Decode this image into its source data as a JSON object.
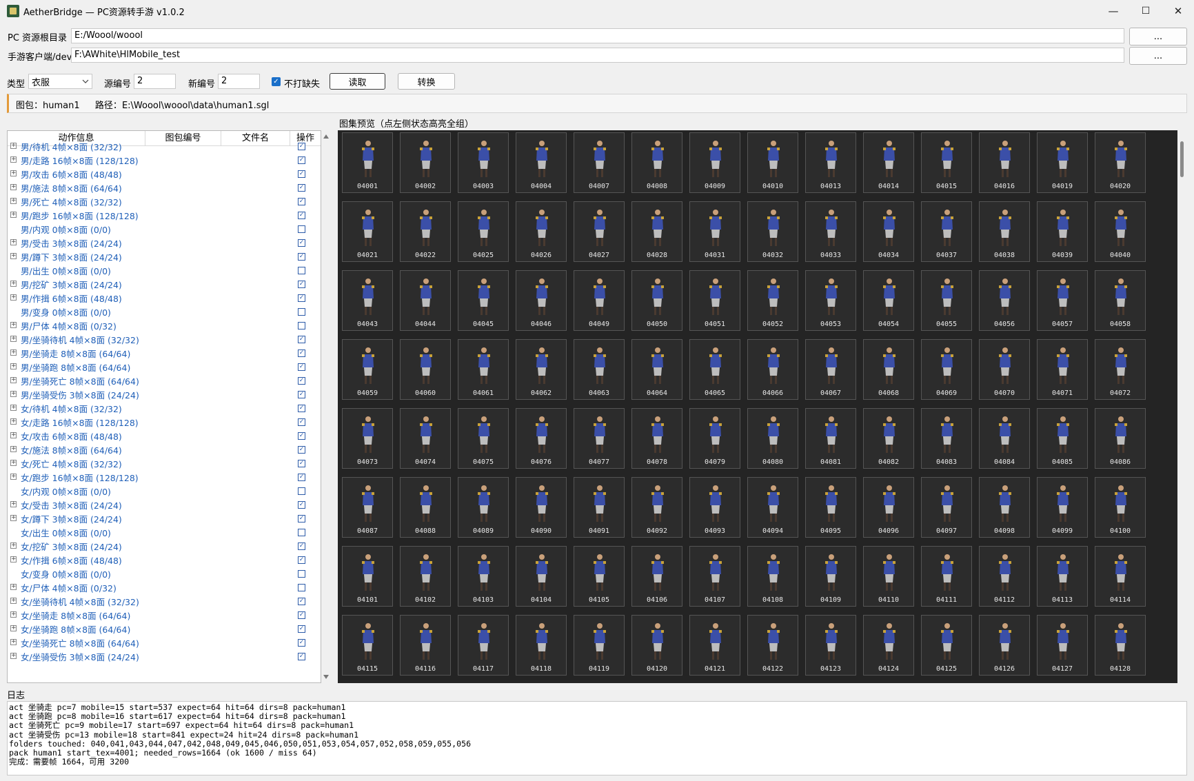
{
  "window": {
    "title": "AetherBridge — PC资源转手游 v1.0.2",
    "minimize": "—",
    "maximize": "☐",
    "close": "✕"
  },
  "paths": {
    "pc_label": "PC 资源根目录",
    "pc_value": "E:/Woool/woool",
    "mobile_label": "手游客户端/dev",
    "mobile_value": "F:\\AWhite\\HlMobile_test",
    "browse_label": "..."
  },
  "options": {
    "type_label": "类型",
    "type_value": "衣服",
    "src_label": "源编号",
    "src_value": "2",
    "new_label": "新编号",
    "new_value": "2",
    "no_pack_label": "不打缺失",
    "no_pack_checked": true,
    "read_button": "读取",
    "convert_button": "转换"
  },
  "info": {
    "pack_label": "图包：",
    "pack_value": "human1",
    "path_label": "路径：",
    "path_value": "E:\\Woool\\woool\\data\\human1.sgl"
  },
  "tree": {
    "headers": [
      "动作信息",
      "图包编号",
      "文件名",
      "操作"
    ],
    "rows": [
      {
        "text": "男/待机  4帧×8面 (32/32)",
        "exp": true,
        "checked": true
      },
      {
        "text": "男/走路  16帧×8面 (128/128)",
        "exp": true,
        "checked": true
      },
      {
        "text": "男/攻击  6帧×8面 (48/48)",
        "exp": true,
        "checked": true
      },
      {
        "text": "男/施法  8帧×8面 (64/64)",
        "exp": true,
        "checked": true
      },
      {
        "text": "男/死亡  4帧×8面 (32/32)",
        "exp": true,
        "checked": true
      },
      {
        "text": "男/跑步  16帧×8面 (128/128)",
        "exp": true,
        "checked": true
      },
      {
        "text": "男/内观  0帧×8面 (0/0)",
        "exp": false,
        "checked": false
      },
      {
        "text": "男/受击  3帧×8面 (24/24)",
        "exp": true,
        "checked": true
      },
      {
        "text": "男/蹲下  3帧×8面 (24/24)",
        "exp": true,
        "checked": true
      },
      {
        "text": "男/出生  0帧×8面 (0/0)",
        "exp": false,
        "checked": false
      },
      {
        "text": "男/挖矿  3帧×8面 (24/24)",
        "exp": true,
        "checked": true
      },
      {
        "text": "男/作揖  6帧×8面 (48/48)",
        "exp": true,
        "checked": true
      },
      {
        "text": "男/变身  0帧×8面 (0/0)",
        "exp": false,
        "checked": false
      },
      {
        "text": "男/尸体  4帧×8面 (0/32)",
        "exp": true,
        "checked": false
      },
      {
        "text": "男/坐骑待机  4帧×8面 (32/32)",
        "exp": true,
        "checked": true
      },
      {
        "text": "男/坐骑走  8帧×8面 (64/64)",
        "exp": true,
        "checked": true
      },
      {
        "text": "男/坐骑跑  8帧×8面 (64/64)",
        "exp": true,
        "checked": true
      },
      {
        "text": "男/坐骑死亡  8帧×8面 (64/64)",
        "exp": true,
        "checked": true
      },
      {
        "text": "男/坐骑受伤  3帧×8面 (24/24)",
        "exp": true,
        "checked": true
      },
      {
        "text": "女/待机  4帧×8面 (32/32)",
        "exp": true,
        "checked": true
      },
      {
        "text": "女/走路  16帧×8面 (128/128)",
        "exp": true,
        "checked": true
      },
      {
        "text": "女/攻击  6帧×8面 (48/48)",
        "exp": true,
        "checked": true
      },
      {
        "text": "女/施法  8帧×8面 (64/64)",
        "exp": true,
        "checked": true
      },
      {
        "text": "女/死亡  4帧×8面 (32/32)",
        "exp": true,
        "checked": true
      },
      {
        "text": "女/跑步  16帧×8面 (128/128)",
        "exp": true,
        "checked": true
      },
      {
        "text": "女/内观  0帧×8面 (0/0)",
        "exp": false,
        "checked": false
      },
      {
        "text": "女/受击  3帧×8面 (24/24)",
        "exp": true,
        "checked": true
      },
      {
        "text": "女/蹲下  3帧×8面 (24/24)",
        "exp": true,
        "checked": true
      },
      {
        "text": "女/出生  0帧×8面 (0/0)",
        "exp": false,
        "checked": false
      },
      {
        "text": "女/挖矿  3帧×8面 (24/24)",
        "exp": true,
        "checked": true
      },
      {
        "text": "女/作揖  6帧×8面 (48/48)",
        "exp": true,
        "checked": true
      },
      {
        "text": "女/变身  0帧×8面 (0/0)",
        "exp": false,
        "checked": false
      },
      {
        "text": "女/尸体  4帧×8面 (0/32)",
        "exp": true,
        "checked": false
      },
      {
        "text": "女/坐骑待机  4帧×8面 (32/32)",
        "exp": true,
        "checked": true
      },
      {
        "text": "女/坐骑走  8帧×8面 (64/64)",
        "exp": true,
        "checked": true
      },
      {
        "text": "女/坐骑跑  8帧×8面 (64/64)",
        "exp": true,
        "checked": true
      },
      {
        "text": "女/坐骑死亡  8帧×8面 (64/64)",
        "exp": true,
        "checked": true
      },
      {
        "text": "女/坐骑受伤  3帧×8面 (24/24)",
        "exp": true,
        "checked": true
      }
    ]
  },
  "atlas": {
    "label": "图集预览（点左侧状态高亮全组）",
    "rows": [
      [
        "04001",
        "04002",
        "04003",
        "04004",
        "04007",
        "04008",
        "04009",
        "04010",
        "04013",
        "04014",
        "04015",
        "04016",
        "04019",
        "04020"
      ],
      [
        "04021",
        "04022",
        "04025",
        "04026",
        "04027",
        "04028",
        "04031",
        "04032",
        "04033",
        "04034",
        "04037",
        "04038",
        "04039",
        "04040"
      ],
      [
        "04043",
        "04044",
        "04045",
        "04046",
        "04049",
        "04050",
        "04051",
        "04052",
        "04053",
        "04054",
        "04055",
        "04056",
        "04057",
        "04058"
      ],
      [
        "04059",
        "04060",
        "04061",
        "04062",
        "04063",
        "04064",
        "04065",
        "04066",
        "04067",
        "04068",
        "04069",
        "04070",
        "04071",
        "04072"
      ],
      [
        "04073",
        "04074",
        "04075",
        "04076",
        "04077",
        "04078",
        "04079",
        "04080",
        "04081",
        "04082",
        "04083",
        "04084",
        "04085",
        "04086"
      ],
      [
        "04087",
        "04088",
        "04089",
        "04090",
        "04091",
        "04092",
        "04093",
        "04094",
        "04095",
        "04096",
        "04097",
        "04098",
        "04099",
        "04100"
      ],
      [
        "04101",
        "04102",
        "04103",
        "04104",
        "04105",
        "04106",
        "04107",
        "04108",
        "04109",
        "04110",
        "04111",
        "04112",
        "04113",
        "04114"
      ],
      [
        "04115",
        "04116",
        "04117",
        "04118",
        "04119",
        "04120",
        "04121",
        "04122",
        "04123",
        "04124",
        "04125",
        "04126",
        "04127",
        "04128"
      ]
    ]
  },
  "log": {
    "label": "日志",
    "lines": [
      "act 坐骑走 pc=7 mobile=15 start=537 expect=64 hit=64 dirs=8 pack=human1",
      "act 坐骑跑 pc=8 mobile=16 start=617 expect=64 hit=64 dirs=8 pack=human1",
      "act 坐骑死亡 pc=9 mobile=17 start=697 expect=64 hit=64 dirs=8 pack=human1",
      "act 坐骑受伤 pc=13 mobile=18 start=841 expect=24 hit=24 dirs=8 pack=human1",
      "folders touched: 040,041,043,044,047,042,048,049,045,046,050,051,053,054,057,052,058,059,055,056",
      "pack human1 start_tex=4001; needed_rows=1664 (ok 1600 / miss 64)",
      "完成：需要帧 1664，可用 3200"
    ]
  }
}
